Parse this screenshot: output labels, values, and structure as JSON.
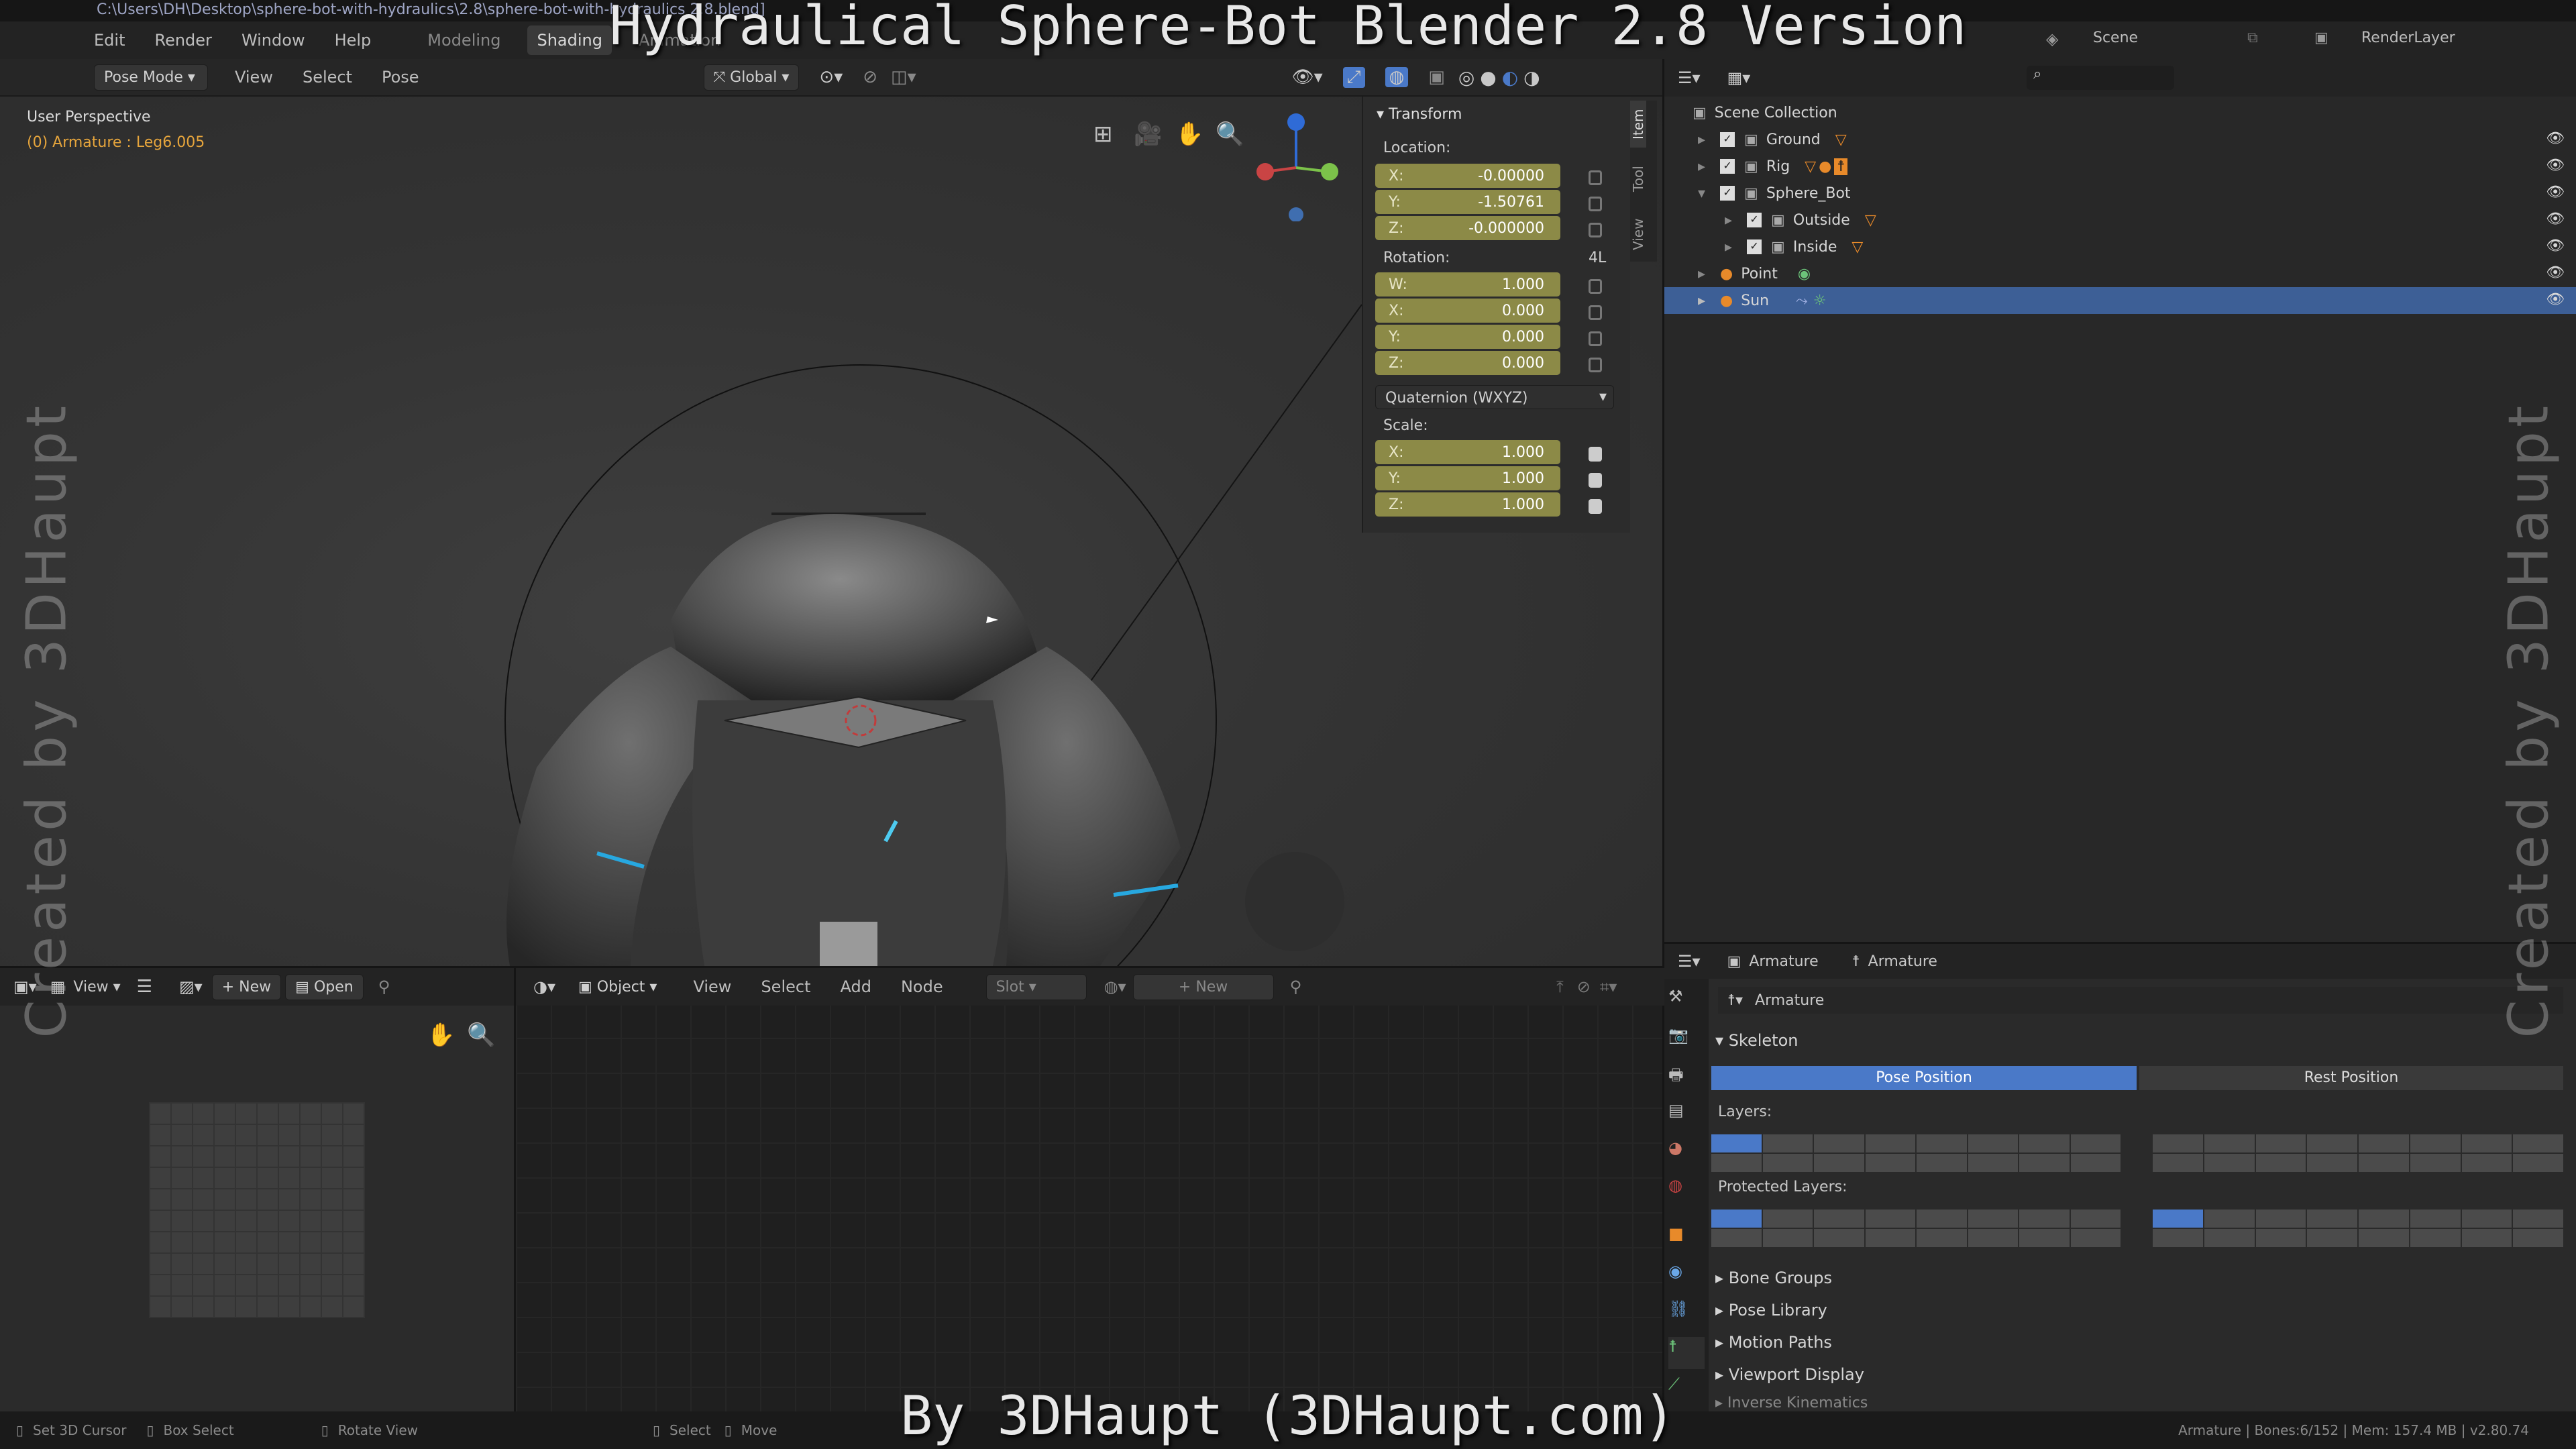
{
  "window": {
    "file_path": "C:\\Users\\DH\\Desktop\\sphere-bot-with-hydraulics\\2.8\\sphere-bot-with-hydraulics 2.8.blend]",
    "overlay_title": "Hydraulical Sphere-Bot Blender 2.8 Version",
    "overlay_credit": "By 3DHaupt (3DHaupt.com)",
    "watermark": "Created by 3DHaupt"
  },
  "menu": {
    "items": [
      "Edit",
      "Render",
      "Window",
      "Help"
    ],
    "workspaces": [
      "Modeling",
      "Shading",
      "Animation"
    ],
    "active_workspace": "Shading",
    "scene_label": "Scene",
    "renderlayer_label": "RenderLayer"
  },
  "viewport_header": {
    "mode": "Pose Mode",
    "menus": [
      "View",
      "Select",
      "Pose"
    ],
    "orientation": "Global"
  },
  "viewport": {
    "perspective_label": "User Perspective",
    "active_label": "(0) Armature : Leg6.005"
  },
  "npanel": {
    "tabs": [
      "Item",
      "Tool",
      "View"
    ],
    "section_title": "Transform",
    "location_label": "Location:",
    "location": [
      {
        "axis": "X:",
        "value": "-0.00000"
      },
      {
        "axis": "Y:",
        "value": "-1.50761"
      },
      {
        "axis": "Z:",
        "value": "-0.000000"
      }
    ],
    "rotation_label": "Rotation:",
    "rotation_mode_short": "4L",
    "rotation": [
      {
        "axis": "W:",
        "value": "1.000"
      },
      {
        "axis": "X:",
        "value": "0.000"
      },
      {
        "axis": "Y:",
        "value": "0.000"
      },
      {
        "axis": "Z:",
        "value": "0.000"
      }
    ],
    "rotation_mode": "Quaternion (WXYZ)",
    "scale_label": "Scale:",
    "scale": [
      {
        "axis": "X:",
        "value": "1.000"
      },
      {
        "axis": "Y:",
        "value": "1.000"
      },
      {
        "axis": "Z:",
        "value": "1.000"
      }
    ]
  },
  "outliner": {
    "root": "Scene Collection",
    "rows": [
      "Ground",
      "Rig",
      "Sphere_Bot",
      "Outside",
      "Inside",
      "Point",
      "Sun"
    ],
    "selected": "Sun"
  },
  "properties": {
    "breadcrumb": [
      "Armature",
      "Armature"
    ],
    "datablock": "Armature",
    "panel": "Skeleton",
    "pose_position": "Pose Position",
    "rest_position": "Rest Position",
    "layers_label": "Layers:",
    "protected_layers_label": "Protected Layers:",
    "collapsed_panels": [
      "Bone Groups",
      "Pose Library",
      "Motion Paths",
      "Viewport Display",
      "Inverse Kinematics"
    ]
  },
  "image_editor": {
    "view": "View",
    "new": "New",
    "open": "Open"
  },
  "node_editor": {
    "object": "Object",
    "menus": [
      "View",
      "Select",
      "Add",
      "Node"
    ],
    "slot": "Slot",
    "new": "New"
  },
  "statusbar": {
    "hints": [
      "Set 3D Cursor",
      "Box Select",
      "Rotate View",
      "Select",
      "Move"
    ],
    "info": "Armature | Bones:6/152 | Mem: 157.4 MB | v2.80.74"
  },
  "colors": {
    "accent": "#3d5f96",
    "field": "#8c8a47",
    "button_blue": "#4a79c8"
  }
}
